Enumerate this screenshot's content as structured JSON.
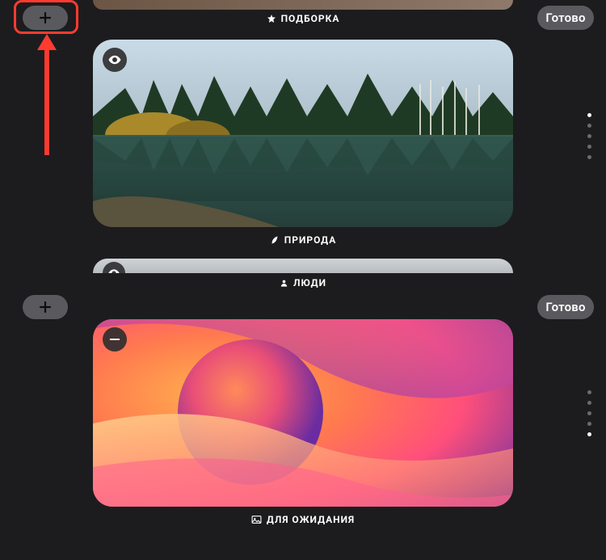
{
  "buttons": {
    "add_top": "+",
    "add_bottom": "+",
    "done_top": "Готово",
    "done_bottom": "Готово"
  },
  "labels": {
    "selection": "ПОДБОРКА",
    "nature": "ПРИРОДА",
    "people": "ЛЮДИ",
    "standby": "ДЛЯ ОЖИДАНИЯ"
  },
  "icons": {
    "star": "star-icon",
    "leaf": "leaf-icon",
    "person": "person-icon",
    "image": "image-icon",
    "eye": "eye-icon",
    "minus": "minus-icon",
    "plus": "plus-icon"
  },
  "dots": {
    "top_count": 5,
    "top_active": 0,
    "bottom_count": 5,
    "bottom_active": 4
  },
  "annotation": {
    "highlight_target": "add-button-top"
  }
}
